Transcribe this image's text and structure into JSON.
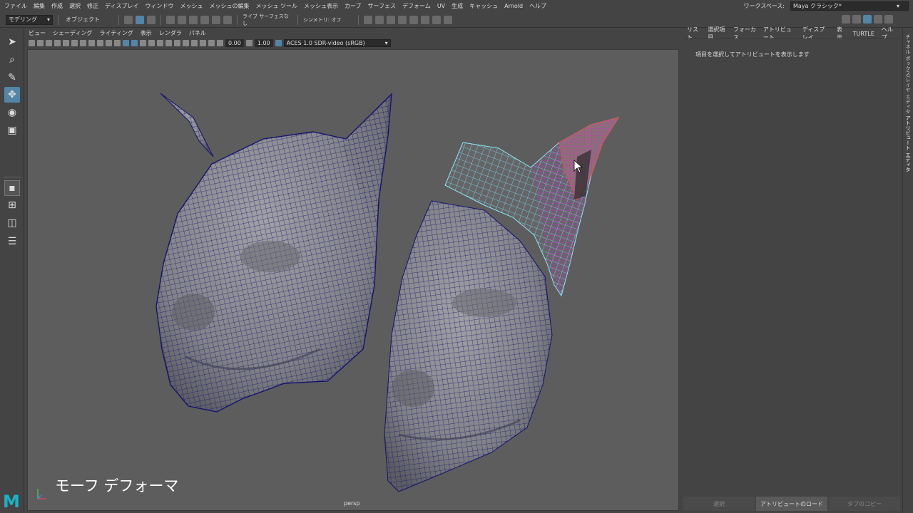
{
  "menubar": {
    "items": [
      "ファイル",
      "編集",
      "作成",
      "選択",
      "修正",
      "ディスプレイ",
      "ウィンドウ",
      "メッシュ",
      "メッシュの編集",
      "メッシュ ツール",
      "メッシュ表示",
      "カーブ",
      "サーフェス",
      "デフォーム",
      "UV",
      "生成",
      "キャッシュ",
      "Arnold",
      "ヘルプ"
    ],
    "workspace_label": "ワークスペース:",
    "workspace_value": "Maya クラシック*"
  },
  "statusline": {
    "mode": "モデリング",
    "selection_mode": "オブジェクト",
    "live_surface": "ライブ サーフェスなし",
    "symmetry": "シンメトリ: オフ"
  },
  "panel": {
    "menu": [
      "ビュー",
      "シェーディング",
      "ライティング",
      "表示",
      "レンダラ",
      "パネル"
    ],
    "value_a": "0.00",
    "value_b": "1.00",
    "color_space": "ACES 1.0 SDR-video (sRGB)"
  },
  "viewport": {
    "caption": "モーフ デフォーマ",
    "camera": "persp",
    "background": "#5d5d5d"
  },
  "attribute_editor": {
    "menu": [
      "リスト",
      "選択項目",
      "フォーカス",
      "アトリビュート",
      "ディスプレイ",
      "表示",
      "TURTLE",
      "ヘルプ"
    ],
    "hint": "項目を選択してアトリビュートを表示します",
    "buttons": [
      "選択",
      "アトリビュートのロード",
      "タブのコピー"
    ]
  },
  "side_tabs": [
    "チャネル ボックス/レイヤ エディタ",
    "アトリビュート エディタ"
  ],
  "colors": {
    "accent": "#5285a6",
    "logo": "#1ab3c8",
    "wire": "#1a1a7a",
    "selection": "#e020e0"
  }
}
